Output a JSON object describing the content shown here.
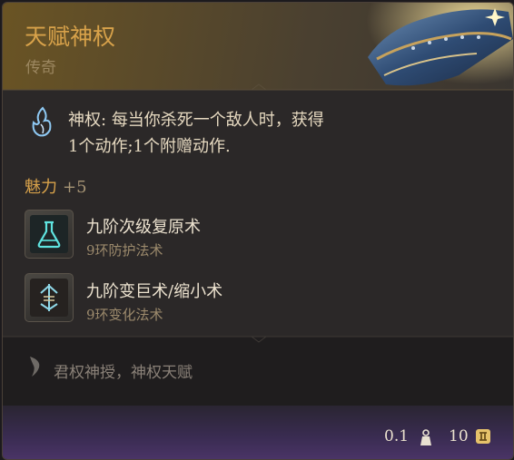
{
  "item": {
    "name": "天赋神权",
    "rarity": "传奇"
  },
  "passive": {
    "name": "神权:",
    "description_line1": "每当你杀死一个敌人时，获得",
    "description_line2": "1个动作;1个附赠动作."
  },
  "stat": {
    "name": "魅力",
    "bonus": "+5"
  },
  "spells": [
    {
      "name": "九阶次级复原术",
      "school": "9环防护法术",
      "icon": "potion-flask-icon"
    },
    {
      "name": "九阶变巨术/缩小术",
      "school": "9环变化法术",
      "icon": "enlarge-reduce-icon"
    }
  ],
  "lore": {
    "text": "君权神授，神权天赋",
    "icon": "quill-icon"
  },
  "footer": {
    "weight": "0.1",
    "price": "10",
    "weight_icon": "weight-icon",
    "price_icon": "gold-coin-icon"
  },
  "colors": {
    "title": "#d8a24a",
    "rarity": "#9c8760",
    "text": "#e6d9c0",
    "muted": "#9c8a6c",
    "footer_purple": "#4a3466"
  }
}
